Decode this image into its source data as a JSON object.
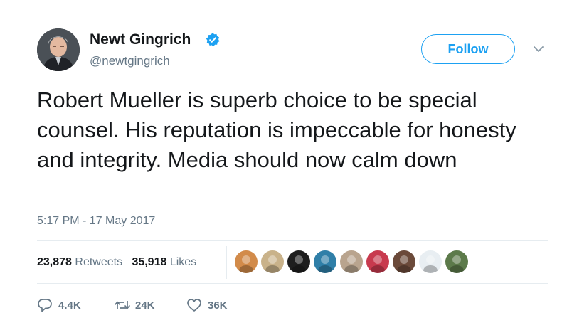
{
  "author": {
    "name": "Newt Gingrich",
    "handle": "@newtgingrich",
    "verified": true,
    "avatar_icon": "profile-photo-icon"
  },
  "header": {
    "follow_label": "Follow",
    "menu_icon": "chevron-down-icon"
  },
  "tweet": {
    "text": "Robert Mueller is superb choice to be special counsel. His reputation is impeccable for honesty and integrity. Media should now calm down",
    "timestamp": "5:17 PM - 17 May 2017"
  },
  "stats": {
    "retweets_count": "23,878",
    "retweets_label": "Retweets",
    "likes_count": "35,918",
    "likes_label": "Likes"
  },
  "likers": [
    {
      "icon": "liker-avatar-icon",
      "color": "#d28b4a"
    },
    {
      "icon": "liker-avatar-icon",
      "color": "#c9b28a"
    },
    {
      "icon": "liker-avatar-icon",
      "color": "#1e1e1e"
    },
    {
      "icon": "liker-avatar-icon",
      "color": "#2f7fa8"
    },
    {
      "icon": "liker-avatar-icon",
      "color": "#b9a48e"
    },
    {
      "icon": "liker-avatar-icon",
      "color": "#c83a4e"
    },
    {
      "icon": "liker-avatar-icon",
      "color": "#6b4a3a"
    },
    {
      "icon": "liker-avatar-icon",
      "color": "#e8eef2"
    },
    {
      "icon": "liker-avatar-icon",
      "color": "#5c7a4a"
    }
  ],
  "actions": {
    "reply_count": "4.4K",
    "retweet_count": "24K",
    "like_count": "36K"
  },
  "colors": {
    "accent": "#1da1f2",
    "text": "#14171a",
    "secondary": "#657786",
    "divider": "#e6ecf0"
  }
}
